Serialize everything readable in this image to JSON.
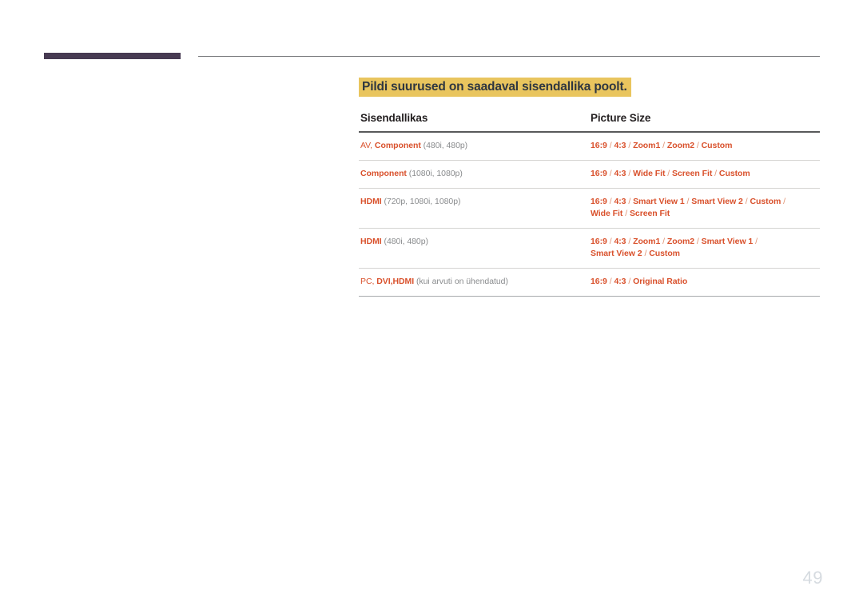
{
  "page": {
    "number": "49"
  },
  "section": {
    "title": "Pildi suurused on saadaval sisendallika poolt.",
    "highlight_color": "#e9c55e",
    "title_color": "#2e3640"
  },
  "table": {
    "accent_color": "#d9512c",
    "note_color": "#8a8c8e",
    "headers": [
      "Sisendallikas",
      "Picture Size"
    ],
    "rows": [
      {
        "source_prefix": "AV",
        "source_comma": ", ",
        "source_main": "Component",
        "source_note": "(480i, 480p)",
        "picture_size_line1": "16:9 / 4:3 / Zoom1 / Zoom2 / Custom",
        "picture_size_line2": ""
      },
      {
        "source_prefix": "",
        "source_comma": "",
        "source_main": "Component",
        "source_note": "(1080i, 1080p)",
        "picture_size_line1": "16:9 / 4:3 / Wide Fit / Screen Fit / Custom",
        "picture_size_line2": ""
      },
      {
        "source_prefix": "",
        "source_comma": "",
        "source_main": "HDMI",
        "source_note": "(720p, 1080i, 1080p)",
        "picture_size_line1": "16:9 / 4:3 / Smart View 1 / Smart View 2 / Custom /",
        "picture_size_line2": "Wide Fit / Screen Fit"
      },
      {
        "source_prefix": "",
        "source_comma": "",
        "source_main": "HDMI",
        "source_note": "(480i, 480p)",
        "picture_size_line1": "16:9 / 4:3 / Zoom1 / Zoom2 / Smart View 1 /",
        "picture_size_line2": "Smart View 2 / Custom"
      },
      {
        "source_prefix": "PC",
        "source_comma": ", ",
        "source_main": "DVI,HDMI",
        "source_note": "(kui arvuti on ühendatud)",
        "picture_size_line1": "16:9 / 4:3 / Original Ratio",
        "picture_size_line2": ""
      }
    ]
  }
}
